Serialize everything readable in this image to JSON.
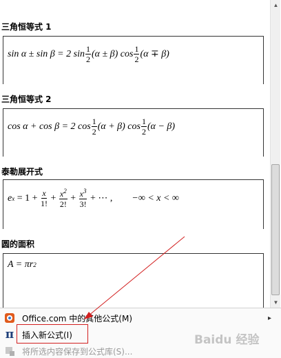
{
  "sections": [
    {
      "title": "三角恒等式 1"
    },
    {
      "title": "三角恒等式 2"
    },
    {
      "title": "泰勒展开式"
    },
    {
      "title": "圆的面积"
    }
  ],
  "equations": {
    "trig1": {
      "lhs": "sin α ± sin β = 2 sin",
      "frac": {
        "num": "1",
        "den": "2"
      },
      "mid1": "(α ± β) cos",
      "mid2": "(α ∓ β)"
    },
    "trig2": {
      "lhs": "cos α + cos β = 2 cos",
      "frac": {
        "num": "1",
        "den": "2"
      },
      "mid1": "(α + β) cos",
      "mid2": "(α − β)"
    },
    "taylor": {
      "base": "e",
      "exp": "x",
      "eq1": " = 1 + ",
      "t1": {
        "num": "x",
        "den": "1!"
      },
      "t2": {
        "num": "x",
        "num_exp": "2",
        "den": "2!"
      },
      "t3": {
        "num": "x",
        "num_exp": "3",
        "den": "3!"
      },
      "tail": " + ⋯ ,",
      "range": "−∞ < x < ∞"
    },
    "circle": {
      "text": "A = πr",
      "exp": "2"
    }
  },
  "menu": {
    "items": [
      {
        "label": "Office.com 中的其他公式(M)",
        "icon": "office-icon",
        "enabled": true,
        "arrow": "▸"
      },
      {
        "label": "插入新公式(I)",
        "icon": "pi-icon",
        "glyph": "π",
        "enabled": true
      },
      {
        "label": "将所选内容保存到公式库(S)...",
        "icon": "save-equation-icon",
        "enabled": false
      }
    ]
  },
  "watermark": "Baidu 经验"
}
